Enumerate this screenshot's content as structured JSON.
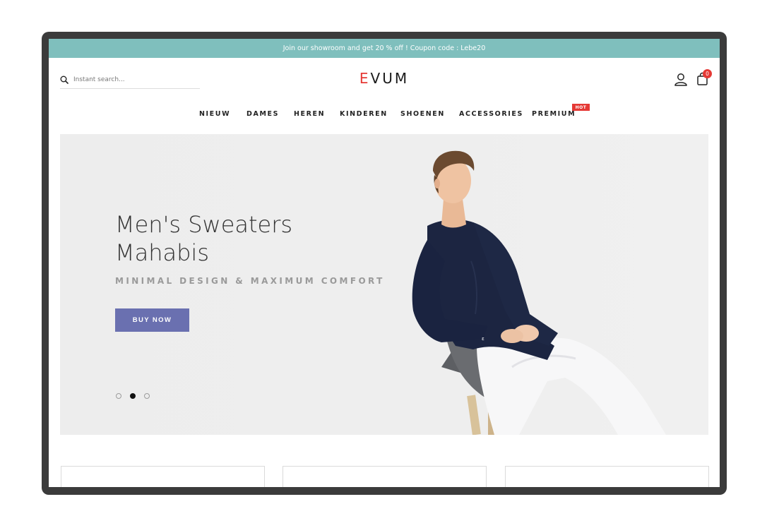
{
  "promo": {
    "text": "Join our showroom and get 20 % off ! Coupon code : Lebe20"
  },
  "search": {
    "placeholder": "Instant search..."
  },
  "logo": {
    "accent_letter": "E",
    "rest": "VUM"
  },
  "header": {
    "cart_count": "0"
  },
  "nav": {
    "items": [
      {
        "label": "NIEUW"
      },
      {
        "label": "DAMES"
      },
      {
        "label": "HEREN"
      },
      {
        "label": "KINDEREN"
      },
      {
        "label": "SHOENEN"
      },
      {
        "label": "ACCESSORIES"
      },
      {
        "label": "PREMIUM"
      }
    ],
    "hot_badge": "HOT"
  },
  "hero": {
    "title_line1": "Men's Sweaters",
    "title_line2": "Mahabis",
    "subtitle": "MINIMAL DESIGN & MAXIMUM COMFORT",
    "cta": "BUY NOW",
    "active_slide": 2,
    "slide_count": 3
  },
  "colors": {
    "promo_bar": "#7fbfbd",
    "cta": "#6a70b0",
    "badge": "#e53935"
  },
  "icons": [
    "search-icon",
    "user-icon",
    "shopping-bag-icon"
  ]
}
